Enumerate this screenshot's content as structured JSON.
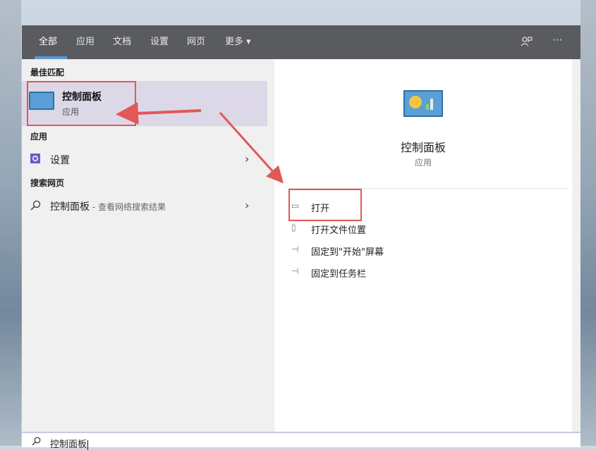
{
  "tabs": [
    {
      "label": "全部"
    },
    {
      "label": "应用"
    },
    {
      "label": "文档"
    },
    {
      "label": "设置"
    },
    {
      "label": "网页"
    },
    {
      "label": "更多"
    }
  ],
  "tab_more_caret": "▾",
  "topbar_icons": {
    "feedback": "feedback-icon",
    "more": "···"
  },
  "sections": {
    "best_match": "最佳匹配",
    "apps": "应用",
    "web": "搜索网页"
  },
  "best_match_item": {
    "title": "控制面板",
    "subtitle": "应用"
  },
  "app_items": [
    {
      "label": "设置"
    }
  ],
  "web_items": [
    {
      "label": "控制面板",
      "hint": " - 查看网络搜索结果"
    }
  ],
  "detail": {
    "title": "控制面板",
    "subtitle": "应用"
  },
  "actions": [
    {
      "label": "打开",
      "icon": "open-icon"
    },
    {
      "label": "打开文件位置",
      "icon": "file-location-icon"
    },
    {
      "label": "固定到\"开始\"屏幕",
      "icon": "pin-icon"
    },
    {
      "label": "固定到任务栏",
      "icon": "pin-icon"
    }
  ],
  "search": {
    "value": "控制面板"
  },
  "colors": {
    "accent": "#5b9bd5",
    "annotation": "#e05858",
    "selected": "#dcd8e8",
    "topbar": "#595b5e"
  }
}
